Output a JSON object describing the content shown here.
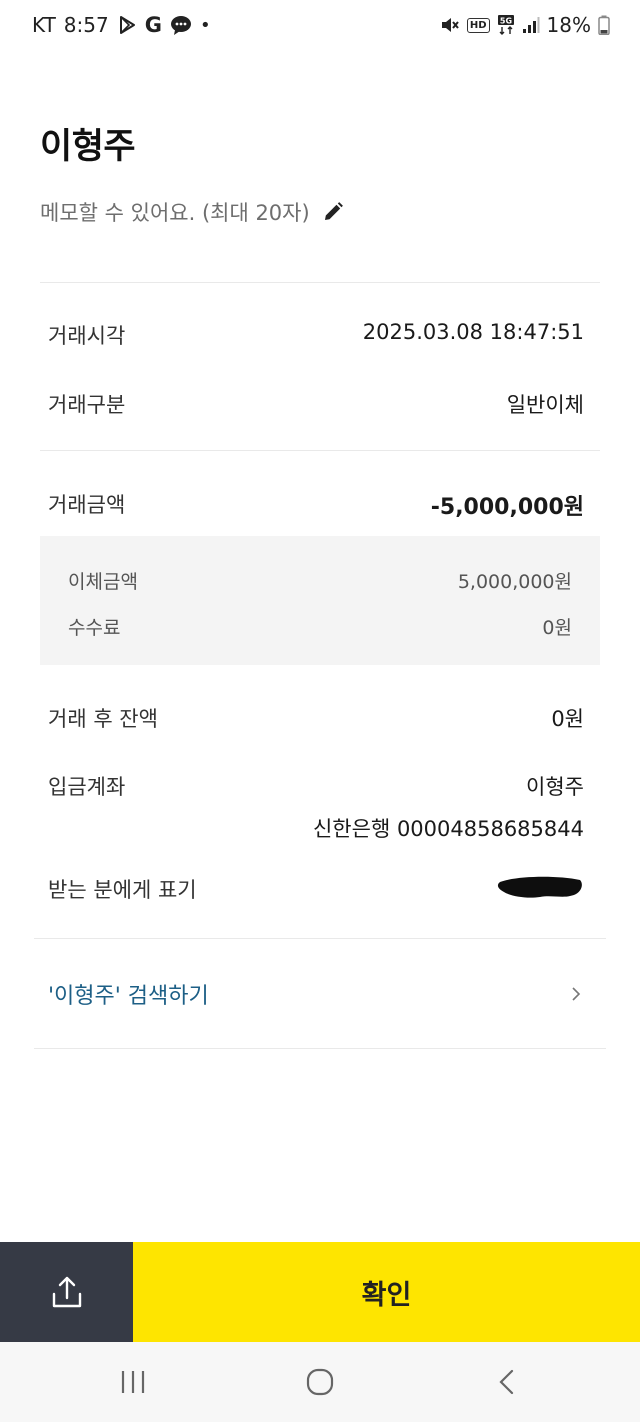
{
  "status_bar": {
    "carrier": "KT",
    "time": "8:57",
    "g_letter": "G",
    "dot": "•",
    "hd": "HD",
    "battery": "18%"
  },
  "header": {
    "name": "이형주",
    "memo_placeholder": "메모할 수 있어요. (최대 20자)"
  },
  "details": {
    "time_label": "거래시각",
    "time_value": "2025.03.08 18:47:51",
    "type_label": "거래구분",
    "type_value": "일반이체",
    "amount_label": "거래금액",
    "amount_value": "-5,000,000원",
    "transfer_label": "이체금액",
    "transfer_value": "5,000,000원",
    "fee_label": "수수료",
    "fee_value": "0원",
    "balance_label": "거래 후 잔액",
    "balance_value": "0원",
    "account_label": "입금계좌",
    "account_name": "이형주",
    "account_bank": "신한은행 00004858685844",
    "display_label": "받는 분에게 표기"
  },
  "search": {
    "label": "'이형주' 검색하기"
  },
  "bottom": {
    "confirm_label": "확인"
  },
  "colors": {
    "accent_yellow": "#fee500",
    "share_bg": "#363a45",
    "link_blue": "#1d5f86"
  },
  "icons": {
    "edit": "pencil-icon",
    "chevron": "chevron-right-icon",
    "share": "share-icon"
  }
}
